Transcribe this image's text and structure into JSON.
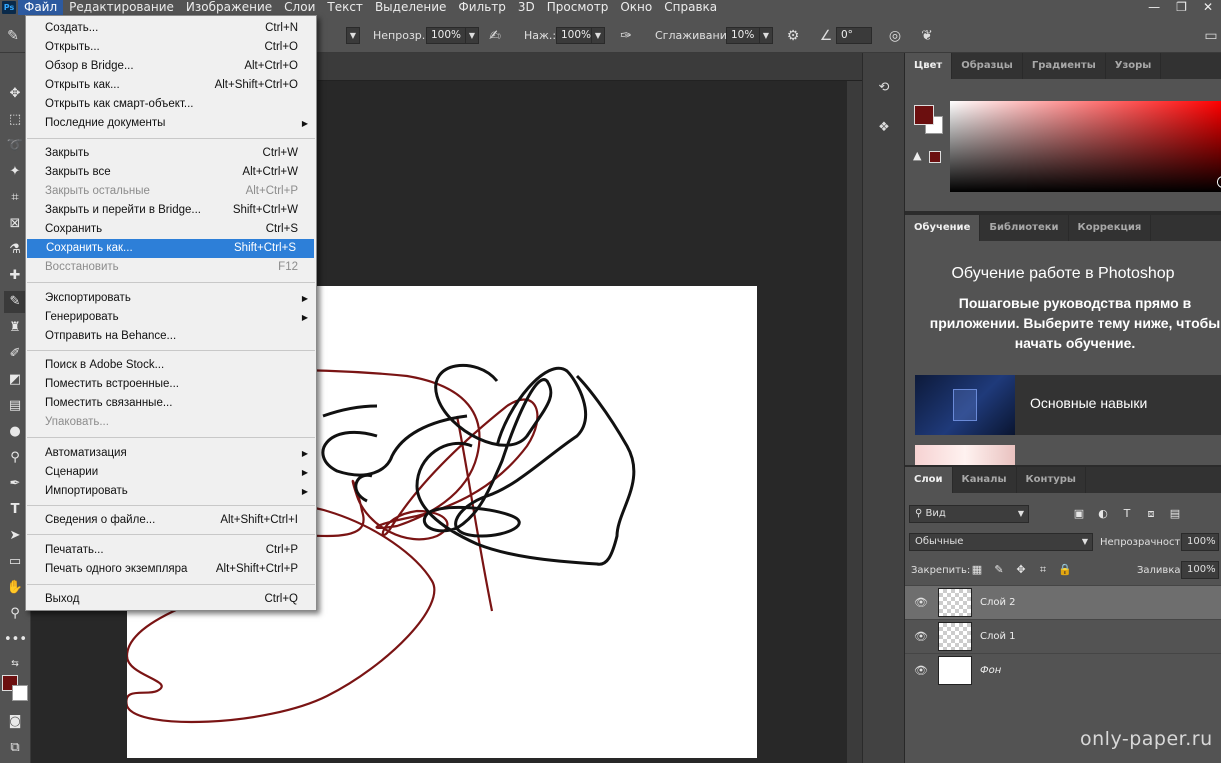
{
  "menubar": {
    "logo": "Ps",
    "items": [
      "Файл",
      "Редактирование",
      "Изображение",
      "Слои",
      "Текст",
      "Выделение",
      "Фильтр",
      "3D",
      "Просмотр",
      "Окно",
      "Справка"
    ],
    "window_controls": [
      "—",
      "❐",
      "✕"
    ]
  },
  "options": {
    "opacity_label": "Непрозр.:",
    "opacity_value": "100%",
    "pressure_label": "Наж.:",
    "pressure_value": "100%",
    "smoothing_label": "Сглаживание:",
    "smoothing_value": "10%",
    "angle_value": "0°"
  },
  "file_menu": {
    "items": [
      {
        "label": "Создать...",
        "shortcut": "Ctrl+N"
      },
      {
        "label": "Открыть...",
        "shortcut": "Ctrl+O"
      },
      {
        "label": "Обзор в Bridge...",
        "shortcut": "Alt+Ctrl+O"
      },
      {
        "label": "Открыть как...",
        "shortcut": "Alt+Shift+Ctrl+O"
      },
      {
        "label": "Открыть как смарт-объект...",
        "shortcut": ""
      },
      {
        "label": "Последние документы",
        "shortcut": ""
      },
      {
        "label": "Закрыть",
        "shortcut": "Ctrl+W"
      },
      {
        "label": "Закрыть все",
        "shortcut": "Alt+Ctrl+W"
      },
      {
        "label": "Закрыть остальные",
        "shortcut": "Alt+Ctrl+P"
      },
      {
        "label": "Закрыть и перейти в Bridge...",
        "shortcut": "Shift+Ctrl+W"
      },
      {
        "label": "Сохранить",
        "shortcut": "Ctrl+S"
      },
      {
        "label": "Сохранить как...",
        "shortcut": "Shift+Ctrl+S"
      },
      {
        "label": "Восстановить",
        "shortcut": "F12"
      },
      {
        "label": "Экспортировать",
        "shortcut": ""
      },
      {
        "label": "Генерировать",
        "shortcut": ""
      },
      {
        "label": "Отправить на Behance...",
        "shortcut": ""
      },
      {
        "label": "Поиск в Adobe Stock...",
        "shortcut": ""
      },
      {
        "label": "Поместить встроенные...",
        "shortcut": ""
      },
      {
        "label": "Поместить связанные...",
        "shortcut": ""
      },
      {
        "label": "Упаковать...",
        "shortcut": ""
      },
      {
        "label": "Автоматизация",
        "shortcut": ""
      },
      {
        "label": "Сценарии",
        "shortcut": ""
      },
      {
        "label": "Импортировать",
        "shortcut": ""
      },
      {
        "label": "Сведения о файле...",
        "shortcut": "Alt+Shift+Ctrl+I"
      },
      {
        "label": "Печатать...",
        "shortcut": "Ctrl+P"
      },
      {
        "label": "Печать одного экземпляра",
        "shortcut": "Alt+Shift+Ctrl+P"
      },
      {
        "label": "Выход",
        "shortcut": "Ctrl+Q"
      }
    ]
  },
  "color_panel": {
    "tabs": [
      "Цвет",
      "Образцы",
      "Градиенты",
      "Узоры"
    ],
    "foreground": "#6b0f0f",
    "background": "#ffffff"
  },
  "learn_panel": {
    "tabs": [
      "Обучение",
      "Библиотеки",
      "Коррекция"
    ],
    "title": "Обучение работе в Photoshop",
    "subtitle": "Пошаговые руководства прямо в приложении. Выберите тему ниже, чтобы начать обучение.",
    "card_label": "Основные навыки"
  },
  "layers_panel": {
    "tabs": [
      "Слои",
      "Каналы",
      "Контуры"
    ],
    "filter_label": "Вид",
    "blend_mode": "Обычные",
    "opacity_label": "Непрозрачность:",
    "opacity_value": "100%",
    "lock_label": "Закрепить:",
    "fill_label": "Заливка:",
    "fill_value": "100%",
    "layers": [
      {
        "name": "Слой 2",
        "selected": true
      },
      {
        "name": "Слой 1",
        "selected": false
      },
      {
        "name": "Фон",
        "selected": false
      }
    ]
  },
  "watermark": "only-paper.ru"
}
